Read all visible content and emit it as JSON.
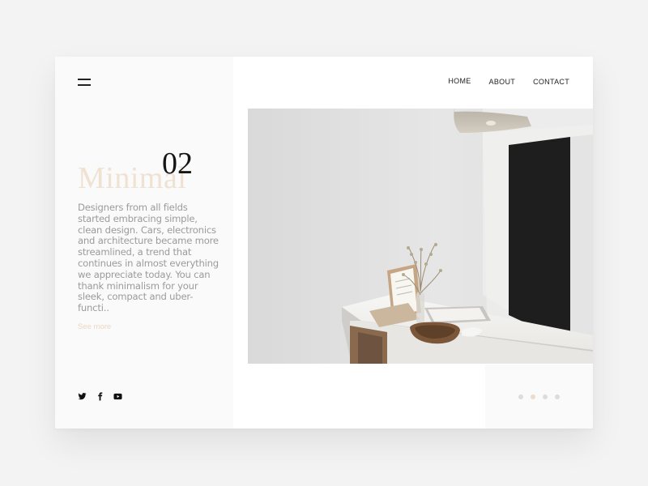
{
  "nav": {
    "menu_icon": "hamburger-menu-icon",
    "items": [
      {
        "label": "HOME"
      },
      {
        "label": "ABOUT"
      },
      {
        "label": "CONTACT"
      }
    ]
  },
  "hero": {
    "title": "Minimal",
    "number": "02",
    "description": "Designers from all fields started embracing simple, clean design. Cars, electronics and architecture became more streamlined, a trend that continues in almost everything we appreciate today. You can thank minimalism for your sleek, compact and uber-functi..",
    "see_more": "See more"
  },
  "social": {
    "icons": [
      "twitter-icon",
      "facebook-icon",
      "youtube-icon"
    ]
  },
  "slider": {
    "total": 4,
    "active_index": 1
  },
  "colors": {
    "accent": "#efe2d2",
    "text_dark": "#151515",
    "text_muted": "#9b9b9b",
    "panel": "#fafafa"
  }
}
